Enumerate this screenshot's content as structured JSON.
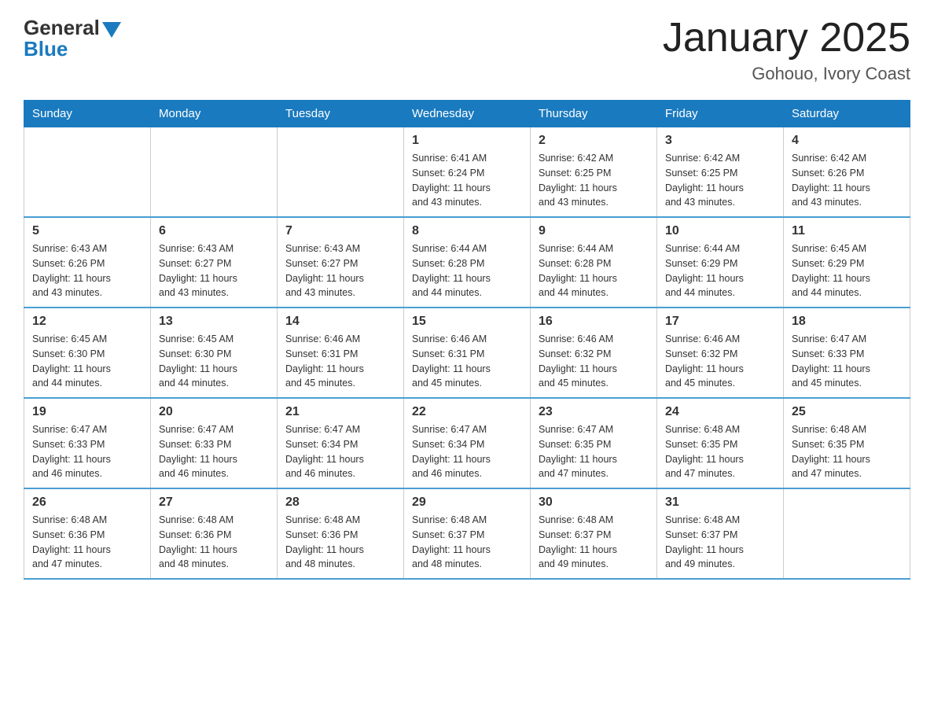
{
  "header": {
    "logo_general": "General",
    "logo_blue": "Blue",
    "month_title": "January 2025",
    "location": "Gohouo, Ivory Coast"
  },
  "days_of_week": [
    "Sunday",
    "Monday",
    "Tuesday",
    "Wednesday",
    "Thursday",
    "Friday",
    "Saturday"
  ],
  "weeks": [
    [
      {
        "day": "",
        "info": ""
      },
      {
        "day": "",
        "info": ""
      },
      {
        "day": "",
        "info": ""
      },
      {
        "day": "1",
        "info": "Sunrise: 6:41 AM\nSunset: 6:24 PM\nDaylight: 11 hours\nand 43 minutes."
      },
      {
        "day": "2",
        "info": "Sunrise: 6:42 AM\nSunset: 6:25 PM\nDaylight: 11 hours\nand 43 minutes."
      },
      {
        "day": "3",
        "info": "Sunrise: 6:42 AM\nSunset: 6:25 PM\nDaylight: 11 hours\nand 43 minutes."
      },
      {
        "day": "4",
        "info": "Sunrise: 6:42 AM\nSunset: 6:26 PM\nDaylight: 11 hours\nand 43 minutes."
      }
    ],
    [
      {
        "day": "5",
        "info": "Sunrise: 6:43 AM\nSunset: 6:26 PM\nDaylight: 11 hours\nand 43 minutes."
      },
      {
        "day": "6",
        "info": "Sunrise: 6:43 AM\nSunset: 6:27 PM\nDaylight: 11 hours\nand 43 minutes."
      },
      {
        "day": "7",
        "info": "Sunrise: 6:43 AM\nSunset: 6:27 PM\nDaylight: 11 hours\nand 43 minutes."
      },
      {
        "day": "8",
        "info": "Sunrise: 6:44 AM\nSunset: 6:28 PM\nDaylight: 11 hours\nand 44 minutes."
      },
      {
        "day": "9",
        "info": "Sunrise: 6:44 AM\nSunset: 6:28 PM\nDaylight: 11 hours\nand 44 minutes."
      },
      {
        "day": "10",
        "info": "Sunrise: 6:44 AM\nSunset: 6:29 PM\nDaylight: 11 hours\nand 44 minutes."
      },
      {
        "day": "11",
        "info": "Sunrise: 6:45 AM\nSunset: 6:29 PM\nDaylight: 11 hours\nand 44 minutes."
      }
    ],
    [
      {
        "day": "12",
        "info": "Sunrise: 6:45 AM\nSunset: 6:30 PM\nDaylight: 11 hours\nand 44 minutes."
      },
      {
        "day": "13",
        "info": "Sunrise: 6:45 AM\nSunset: 6:30 PM\nDaylight: 11 hours\nand 44 minutes."
      },
      {
        "day": "14",
        "info": "Sunrise: 6:46 AM\nSunset: 6:31 PM\nDaylight: 11 hours\nand 45 minutes."
      },
      {
        "day": "15",
        "info": "Sunrise: 6:46 AM\nSunset: 6:31 PM\nDaylight: 11 hours\nand 45 minutes."
      },
      {
        "day": "16",
        "info": "Sunrise: 6:46 AM\nSunset: 6:32 PM\nDaylight: 11 hours\nand 45 minutes."
      },
      {
        "day": "17",
        "info": "Sunrise: 6:46 AM\nSunset: 6:32 PM\nDaylight: 11 hours\nand 45 minutes."
      },
      {
        "day": "18",
        "info": "Sunrise: 6:47 AM\nSunset: 6:33 PM\nDaylight: 11 hours\nand 45 minutes."
      }
    ],
    [
      {
        "day": "19",
        "info": "Sunrise: 6:47 AM\nSunset: 6:33 PM\nDaylight: 11 hours\nand 46 minutes."
      },
      {
        "day": "20",
        "info": "Sunrise: 6:47 AM\nSunset: 6:33 PM\nDaylight: 11 hours\nand 46 minutes."
      },
      {
        "day": "21",
        "info": "Sunrise: 6:47 AM\nSunset: 6:34 PM\nDaylight: 11 hours\nand 46 minutes."
      },
      {
        "day": "22",
        "info": "Sunrise: 6:47 AM\nSunset: 6:34 PM\nDaylight: 11 hours\nand 46 minutes."
      },
      {
        "day": "23",
        "info": "Sunrise: 6:47 AM\nSunset: 6:35 PM\nDaylight: 11 hours\nand 47 minutes."
      },
      {
        "day": "24",
        "info": "Sunrise: 6:48 AM\nSunset: 6:35 PM\nDaylight: 11 hours\nand 47 minutes."
      },
      {
        "day": "25",
        "info": "Sunrise: 6:48 AM\nSunset: 6:35 PM\nDaylight: 11 hours\nand 47 minutes."
      }
    ],
    [
      {
        "day": "26",
        "info": "Sunrise: 6:48 AM\nSunset: 6:36 PM\nDaylight: 11 hours\nand 47 minutes."
      },
      {
        "day": "27",
        "info": "Sunrise: 6:48 AM\nSunset: 6:36 PM\nDaylight: 11 hours\nand 48 minutes."
      },
      {
        "day": "28",
        "info": "Sunrise: 6:48 AM\nSunset: 6:36 PM\nDaylight: 11 hours\nand 48 minutes."
      },
      {
        "day": "29",
        "info": "Sunrise: 6:48 AM\nSunset: 6:37 PM\nDaylight: 11 hours\nand 48 minutes."
      },
      {
        "day": "30",
        "info": "Sunrise: 6:48 AM\nSunset: 6:37 PM\nDaylight: 11 hours\nand 49 minutes."
      },
      {
        "day": "31",
        "info": "Sunrise: 6:48 AM\nSunset: 6:37 PM\nDaylight: 11 hours\nand 49 minutes."
      },
      {
        "day": "",
        "info": ""
      }
    ]
  ]
}
